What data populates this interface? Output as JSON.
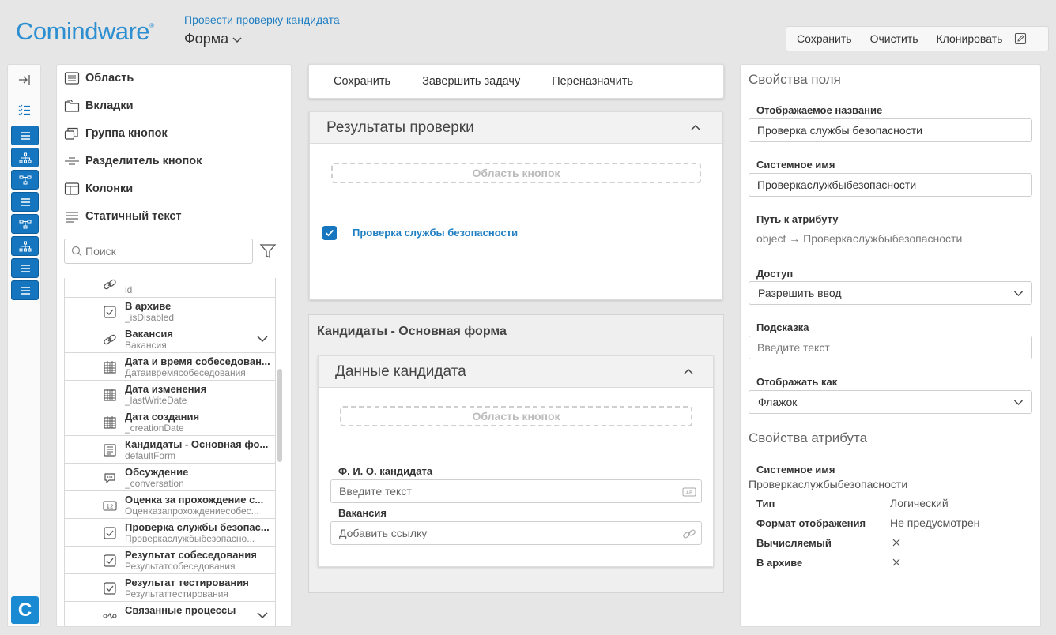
{
  "header": {
    "logo": "Comindware",
    "logo_reg": "®",
    "process_link": "Провести проверку кандидата",
    "form_title": "Форма"
  },
  "top_toolbar": {
    "save": "Сохранить",
    "clear": "Очистить",
    "clone": "Клонировать"
  },
  "rail": {
    "logo_letter": "C"
  },
  "components": {
    "items": [
      {
        "label": "Область",
        "icon": "region-icon"
      },
      {
        "label": "Вкладки",
        "icon": "tabs-icon"
      },
      {
        "label": "Группа кнопок",
        "icon": "button-group-icon"
      },
      {
        "label": "Разделитель кнопок",
        "icon": "button-separator-icon"
      },
      {
        "label": "Колонки",
        "icon": "columns-icon"
      },
      {
        "label": "Статичный текст",
        "icon": "static-text-icon"
      }
    ],
    "search_placeholder": "Поиск"
  },
  "attributes": [
    {
      "name": "",
      "sys": "id",
      "icon": "link-icon"
    },
    {
      "name": "В архиве",
      "sys": "_isDisabled",
      "icon": "checkbox-icon"
    },
    {
      "name": "Вакансия",
      "sys": "Вакансия",
      "icon": "link-icon",
      "expandable": true
    },
    {
      "name": "Дата и время собеседован...",
      "sys": "Датаивремясобеседования",
      "icon": "calendar-icon"
    },
    {
      "name": "Дата изменения",
      "sys": "_lastWriteDate",
      "icon": "calendar-icon"
    },
    {
      "name": "Дата создания",
      "sys": "_creationDate",
      "icon": "calendar-icon"
    },
    {
      "name": "Кандидаты - Основная фо...",
      "sys": "defaultForm",
      "icon": "form-icon"
    },
    {
      "name": "Обсуждение",
      "sys": "_conversation",
      "icon": "chat-icon"
    },
    {
      "name": "Оценка за прохождение с...",
      "sys": "Оценказапрохождениесобес...",
      "icon": "number-icon"
    },
    {
      "name": "Проверка службы безопас...",
      "sys": "Проверкаслужбыбезопасно...",
      "icon": "checkbox-icon"
    },
    {
      "name": "Результат собеседования",
      "sys": "Результатсобеседования",
      "icon": "checkbox-icon"
    },
    {
      "name": "Результат тестирования",
      "sys": "Результаттестирования",
      "icon": "checkbox-icon"
    },
    {
      "name": "Связанные процессы",
      "sys": "",
      "icon": "process-icon",
      "expandable": true
    }
  ],
  "center_toolbar": {
    "save": "Сохранить",
    "complete": "Завершить задачу",
    "reassign": "Переназначить"
  },
  "results_card": {
    "title": "Результаты проверки",
    "button_area": "Область кнопок",
    "checkbox_label": "Проверка службы безопасности",
    "checked": true
  },
  "embedded_form": {
    "title": "Кандидаты - Основная форма",
    "card_title": "Данные кандидата",
    "button_area": "Область кнопок",
    "fio_label": "Ф. И. О. кандидата",
    "fio_placeholder": "Введите текст",
    "vacancy_label": "Вакансия",
    "vacancy_placeholder": "Добавить ссылку"
  },
  "field_props": {
    "section_title": "Свойства поля",
    "display_name_label": "Отображаемое название",
    "display_name_value": "Проверка службы безопасности",
    "system_name_label": "Системное имя",
    "system_name_value": "Проверкаслужбыбезопасности",
    "path_label": "Путь к атрибуту",
    "path_value": "object → Проверкаслужбыбезопасности",
    "access_label": "Доступ",
    "access_value": "Разрешить ввод",
    "hint_label": "Подсказка",
    "hint_placeholder": "Введите текст",
    "display_as_label": "Отображать как",
    "display_as_value": "Флажок"
  },
  "attr_props": {
    "section_title": "Свойства атрибута",
    "system_name_label": "Системное имя",
    "system_name_value": "Проверкаслужбыбезопасности",
    "type_label": "Тип",
    "type_value": "Логический",
    "format_label": "Формат отображения",
    "format_value": "Не предусмотрен",
    "calculated_label": "Вычисляемый",
    "archived_label": "В архиве"
  },
  "colors": {
    "accent": "#1576bf",
    "link": "#1f7fc2",
    "logo": "#2e8fd0"
  }
}
